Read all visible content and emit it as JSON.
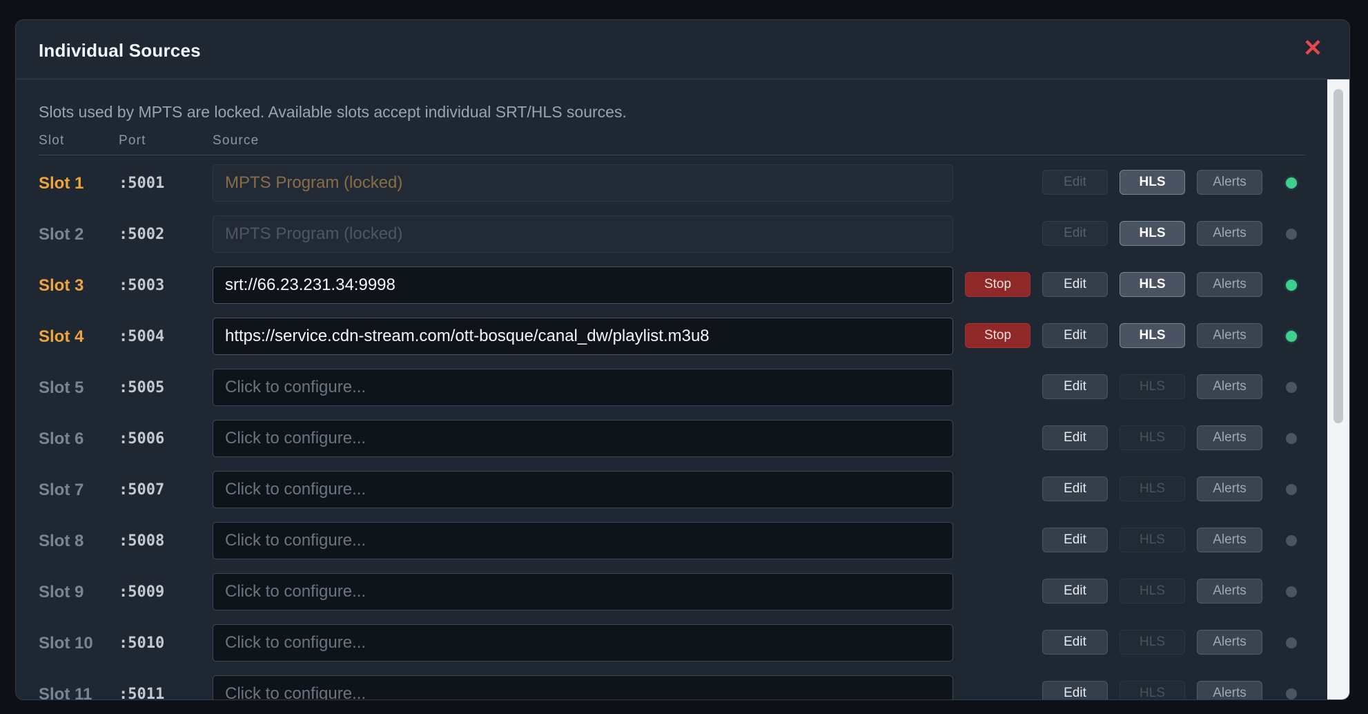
{
  "modal": {
    "title": "Individual Sources",
    "close_glyph": "✕",
    "intro": "Slots used by MPTS are locked. Available slots accept individual SRT/HLS sources.",
    "columns": {
      "slot": "Slot",
      "port": "Port",
      "source": "Source"
    }
  },
  "labels": {
    "stop": "Stop",
    "edit": "Edit",
    "hls": "HLS",
    "alerts": "Alerts"
  },
  "colors": {
    "active_slot": "#f0a43a",
    "status_on": "#3ecf8e",
    "stop": "#8f2828"
  },
  "rows": [
    {
      "slot": "Slot 1",
      "port": ":5001",
      "source": "MPTS Program (locked)",
      "mode": "locked",
      "active": true,
      "stop": false,
      "edit_enabled": false,
      "hls_enabled": true,
      "online": true
    },
    {
      "slot": "Slot 2",
      "port": ":5002",
      "source": "MPTS Program (locked)",
      "mode": "locked",
      "active": false,
      "stop": false,
      "edit_enabled": false,
      "hls_enabled": true,
      "online": false
    },
    {
      "slot": "Slot 3",
      "port": ":5003",
      "source": "srt://66.23.231.34:9998",
      "mode": "filled",
      "active": true,
      "stop": true,
      "edit_enabled": true,
      "hls_enabled": true,
      "online": true
    },
    {
      "slot": "Slot 4",
      "port": ":5004",
      "source": "https://service.cdn-stream.com/ott-bosque/canal_dw/playlist.m3u8",
      "mode": "filled",
      "active": true,
      "stop": true,
      "edit_enabled": true,
      "hls_enabled": true,
      "online": true
    },
    {
      "slot": "Slot 5",
      "port": ":5005",
      "source": "Click to configure...",
      "mode": "empty",
      "active": false,
      "stop": false,
      "edit_enabled": true,
      "hls_enabled": false,
      "online": false
    },
    {
      "slot": "Slot 6",
      "port": ":5006",
      "source": "Click to configure...",
      "mode": "empty",
      "active": false,
      "stop": false,
      "edit_enabled": true,
      "hls_enabled": false,
      "online": false
    },
    {
      "slot": "Slot 7",
      "port": ":5007",
      "source": "Click to configure...",
      "mode": "empty",
      "active": false,
      "stop": false,
      "edit_enabled": true,
      "hls_enabled": false,
      "online": false
    },
    {
      "slot": "Slot 8",
      "port": ":5008",
      "source": "Click to configure...",
      "mode": "empty",
      "active": false,
      "stop": false,
      "edit_enabled": true,
      "hls_enabled": false,
      "online": false
    },
    {
      "slot": "Slot 9",
      "port": ":5009",
      "source": "Click to configure...",
      "mode": "empty",
      "active": false,
      "stop": false,
      "edit_enabled": true,
      "hls_enabled": false,
      "online": false
    },
    {
      "slot": "Slot 10",
      "port": ":5010",
      "source": "Click to configure...",
      "mode": "empty",
      "active": false,
      "stop": false,
      "edit_enabled": true,
      "hls_enabled": false,
      "online": false
    },
    {
      "slot": "Slot 11",
      "port": ":5011",
      "source": "Click to configure...",
      "mode": "empty",
      "active": false,
      "stop": false,
      "edit_enabled": true,
      "hls_enabled": false,
      "online": false
    }
  ]
}
